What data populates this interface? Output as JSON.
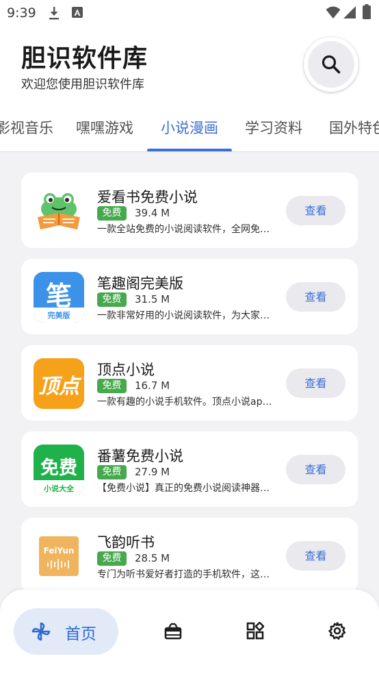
{
  "status": {
    "time": "9:39"
  },
  "header": {
    "title": "胆识软件库",
    "subtitle": "欢迎您使用胆识软件库"
  },
  "tabs": [
    {
      "label": "影视音乐"
    },
    {
      "label": "嘿嘿游戏"
    },
    {
      "label": "小说漫画"
    },
    {
      "label": "学习资料"
    },
    {
      "label": "国外特色"
    }
  ],
  "apps": [
    {
      "name": "爱看书免费小说",
      "tag": "免费",
      "size": "39.4 M",
      "desc": "一款全站免费的小说阅读软件，全网免…",
      "button": "查看"
    },
    {
      "name": "笔趣阁完美版",
      "tag": "免费",
      "size": "31.5 M",
      "desc": "一款非常好用的小说阅读软件，为大家…",
      "button": "查看",
      "icon_text": "笔",
      "icon_sub": "完美版"
    },
    {
      "name": "顶点小说",
      "tag": "免费",
      "size": "16.7 M",
      "desc": "一款有趣的小说手机软件。顶点小说ap…",
      "button": "查看",
      "icon_text": "顶点"
    },
    {
      "name": "番薯免费小说",
      "tag": "免费",
      "size": "27.9 M",
      "desc": "【免费小说】真正的免费小说阅读神器…",
      "button": "查看",
      "icon_text": "免费",
      "icon_sub": "小说大全"
    },
    {
      "name": "飞韵听书",
      "tag": "免费",
      "size": "28.5 M",
      "desc": "专门为听书爱好者打造的手机软件，这…",
      "button": "查看",
      "icon_text": "FeiYun"
    }
  ],
  "nav": {
    "home_label": "首页"
  },
  "colors": {
    "accent": "#3d6fd6",
    "tag_green": "#46a94e",
    "background": "#f2f2f4"
  }
}
